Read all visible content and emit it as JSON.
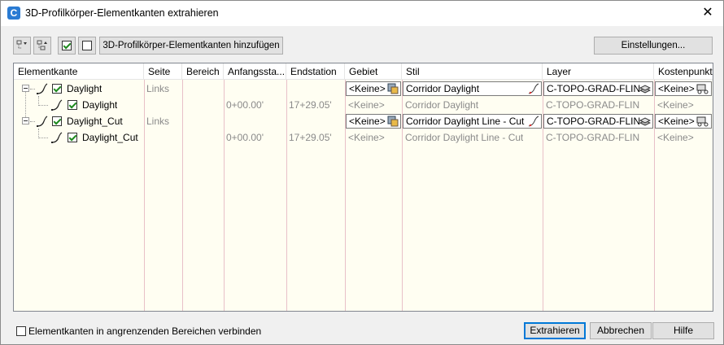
{
  "window": {
    "title": "3D-Profilkörper-Elementkanten extrahieren"
  },
  "toolbar": {
    "add_button": "3D-Profilkörper-Elementkanten hinzufügen",
    "settings_button": "Einstellungen..."
  },
  "columns": [
    "Elementkante",
    "Seite",
    "Bereich",
    "Anfangssta...",
    "Endstation",
    "Gebiet",
    "Stil",
    "Layer",
    "Kostenpunkt"
  ],
  "rows": [
    {
      "name": "Daylight",
      "side": "Links",
      "start": "",
      "end": "",
      "gebiet": "<Keine>",
      "stil": "Corridor Daylight",
      "layer": "C-TOPO-GRAD-FLIN",
      "kosten": "<Keine>"
    },
    {
      "name": "Daylight",
      "side": "",
      "start": "0+00.00'",
      "end": "17+29.05'",
      "gebiet": "<Keine>",
      "stil": "Corridor Daylight",
      "layer": "C-TOPO-GRAD-FLIN",
      "kosten": "<Keine>"
    },
    {
      "name": "Daylight_Cut",
      "side": "Links",
      "start": "",
      "end": "",
      "gebiet": "<Keine>",
      "stil": "Corridor Daylight Line - Cut",
      "layer": "C-TOPO-GRAD-FLIN",
      "kosten": "<Keine>"
    },
    {
      "name": "Daylight_Cut",
      "side": "",
      "start": "0+00.00'",
      "end": "17+29.05'",
      "gebiet": "<Keine>",
      "stil": "Corridor Daylight Line - Cut",
      "layer": "C-TOPO-GRAD-FLIN",
      "kosten": "<Keine>"
    }
  ],
  "footer": {
    "connect_label": "Elementkanten in angrenzenden Bereichen verbinden",
    "extract_button": "Extrahieren",
    "cancel_button": "Abbrechen",
    "help_button": "Hilfe"
  },
  "colors": {
    "accent": "#0078d7",
    "grid_bg": "#fffef2",
    "divider": "#e8c0c8"
  }
}
